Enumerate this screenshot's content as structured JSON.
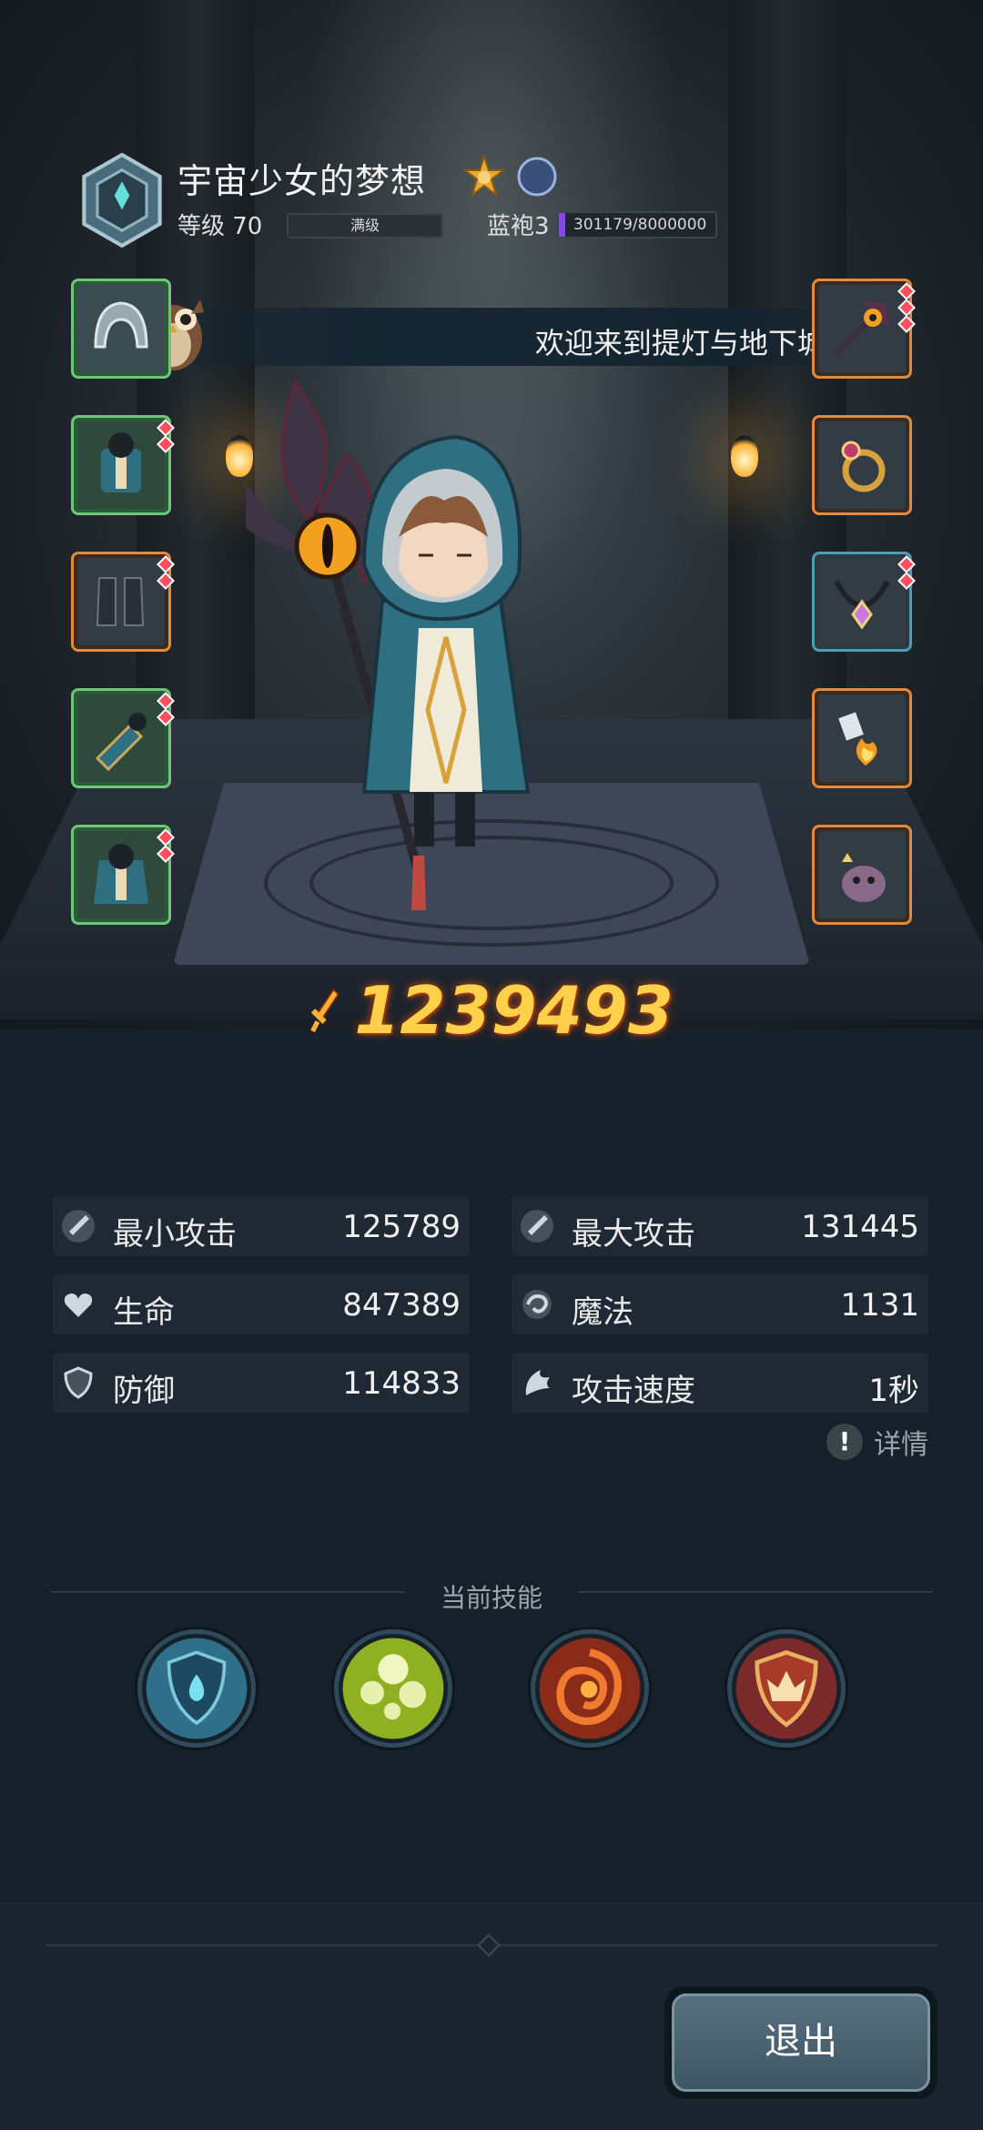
{
  "player": {
    "name": "宇宙少女的梦想",
    "level_label": "等级 70",
    "level_bar_text": "满级",
    "rank_label": "蓝袍3",
    "rank_progress_text": "301179/8000000",
    "rank_progress_fraction": 0.038
  },
  "banner": {
    "message": "欢迎来到提灯与地下城,"
  },
  "equipment": {
    "left": [
      "helmet",
      "armor",
      "boots",
      "bracer",
      "cloak"
    ],
    "right": [
      "weapon",
      "ring",
      "necklace",
      "amulet",
      "pet"
    ]
  },
  "power": {
    "value": "1239493"
  },
  "stats": {
    "min_attack": {
      "label": "最小攻击",
      "value": "125789"
    },
    "max_attack": {
      "label": "最大攻击",
      "value": "131445"
    },
    "hp": {
      "label": "生命",
      "value": "847389"
    },
    "magic": {
      "label": "魔法",
      "value": "1131"
    },
    "defense": {
      "label": "防御",
      "value": "114833"
    },
    "attack_speed": {
      "label": "攻击速度",
      "value": "1秒"
    },
    "details_label": "详情"
  },
  "skills": {
    "title": "当前技能",
    "items": [
      "water-shield-icon",
      "bubbles-icon",
      "fire-vortex-icon",
      "flame-shield-icon"
    ]
  },
  "footer": {
    "exit_label": "退出"
  },
  "colors": {
    "power": "#ffd04a",
    "slot_green": "#6cc878",
    "slot_orange": "#e38a3c",
    "background": "#16202a"
  }
}
